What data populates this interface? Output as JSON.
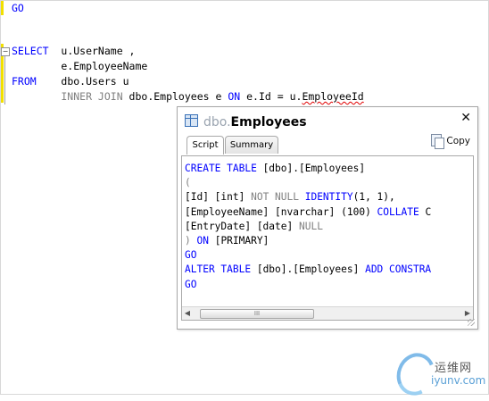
{
  "editor": {
    "lines": [
      {
        "tokens": [
          {
            "t": "GO",
            "c": "kw"
          }
        ]
      },
      {
        "tokens": [
          {
            "t": "SELECT",
            "c": "kw"
          },
          {
            "t": "  u.UserName ,",
            "c": "ink"
          }
        ]
      },
      {
        "tokens": [
          {
            "t": "        e.EmployeeName",
            "c": "ink"
          }
        ]
      },
      {
        "tokens": [
          {
            "t": "FROM",
            "c": "kw"
          },
          {
            "t": "    dbo.Users u",
            "c": "ink"
          }
        ]
      },
      {
        "tokens": [
          {
            "t": "        INNER JOIN",
            "c": "gray"
          },
          {
            "t": " dbo.Employees e ",
            "c": "ink"
          },
          {
            "t": "ON",
            "c": "kw"
          },
          {
            "t": " e.Id = u.",
            "c": "ink"
          },
          {
            "t": "EmployeeId",
            "c": "ink squig"
          }
        ]
      }
    ],
    "collapse_symbol": "−"
  },
  "popup": {
    "schema": "dbo.",
    "table": "Employees",
    "close_label": "✕",
    "tabs": [
      "Script",
      "Summary"
    ],
    "copy_label": "Copy",
    "scroll_thumb_label": "III",
    "scroll_left": "◀",
    "scroll_right": "▶",
    "script_lines": [
      [
        {
          "t": "CREATE TABLE ",
          "c": "kw"
        },
        {
          "t": "[dbo].[Employees]",
          "c": "ink"
        }
      ],
      [
        {
          "t": "(",
          "c": "gray"
        }
      ],
      [
        {
          "t": "[Id] [int] ",
          "c": "ink"
        },
        {
          "t": "NOT NULL ",
          "c": "gray"
        },
        {
          "t": "IDENTITY",
          "c": "kw"
        },
        {
          "t": "(1, 1),",
          "c": "ink"
        }
      ],
      [
        {
          "t": "[EmployeeName] [nvarchar] ",
          "c": "ink"
        },
        {
          "t": "(100) ",
          "c": "ink"
        },
        {
          "t": "COLLATE ",
          "c": "kw"
        },
        {
          "t": "C",
          "c": "ink"
        }
      ],
      [
        {
          "t": "[EntryDate] [date] ",
          "c": "ink"
        },
        {
          "t": "NULL",
          "c": "gray"
        }
      ],
      [
        {
          "t": ") ",
          "c": "gray"
        },
        {
          "t": "ON ",
          "c": "kw"
        },
        {
          "t": "[PRIMARY]",
          "c": "ink"
        }
      ],
      [
        {
          "t": "GO",
          "c": "kw"
        }
      ],
      [
        {
          "t": "ALTER TABLE ",
          "c": "kw"
        },
        {
          "t": "[dbo].[Employees] ",
          "c": "ink"
        },
        {
          "t": "ADD CONSTRA",
          "c": "kw"
        }
      ],
      [
        {
          "t": "GO",
          "c": "kw"
        }
      ]
    ]
  },
  "watermark": {
    "line1": "运维网",
    "line2": "iyunv.com"
  },
  "colors": {
    "keyword": "#0000ff",
    "gray": "#808080",
    "gutter": "#f2e000"
  }
}
